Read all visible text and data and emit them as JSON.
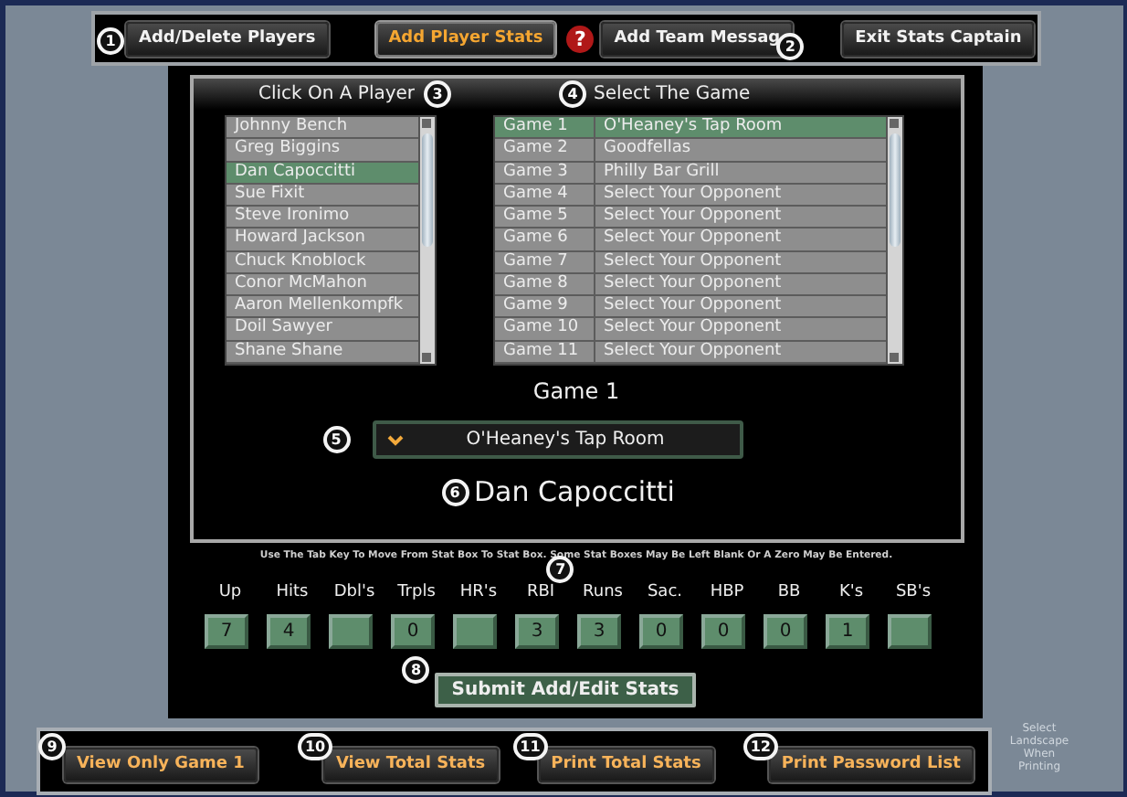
{
  "top_buttons": [
    {
      "label": "Add/Delete Players",
      "selected": false,
      "badge": "1"
    },
    {
      "label": "Add Player Stats",
      "selected": true
    },
    {
      "label": "Add Team Messag",
      "selected": false,
      "badge": "2"
    },
    {
      "label": "Exit Stats Captain",
      "selected": false
    }
  ],
  "help_button": {
    "label": "?"
  },
  "players": {
    "heading": "Click On A Player",
    "badge": "3",
    "items": [
      {
        "name": "Johnny Bench",
        "selected": false
      },
      {
        "name": "Greg Biggins",
        "selected": false
      },
      {
        "name": "Dan Capoccitti",
        "selected": true
      },
      {
        "name": "Sue Fixit",
        "selected": false
      },
      {
        "name": "Steve Ironimo",
        "selected": false
      },
      {
        "name": "Howard Jackson",
        "selected": false
      },
      {
        "name": "Chuck Knoblock",
        "selected": false
      },
      {
        "name": "Conor McMahon",
        "selected": false
      },
      {
        "name": "Aaron Mellenkompfk",
        "selected": false
      },
      {
        "name": "Doil Sawyer",
        "selected": false
      },
      {
        "name": "Shane Shane",
        "selected": false
      }
    ]
  },
  "games": {
    "heading": "Select The Game",
    "badge": "4",
    "items": [
      {
        "game": "Game 1",
        "opponent": "O'Heaney's Tap Room",
        "selected": true
      },
      {
        "game": "Game 2",
        "opponent": "Goodfellas",
        "selected": false
      },
      {
        "game": "Game 3",
        "opponent": "Philly Bar Grill",
        "selected": false
      },
      {
        "game": "Game 4",
        "opponent": "Select Your Opponent",
        "selected": false
      },
      {
        "game": "Game 5",
        "opponent": "Select Your Opponent",
        "selected": false
      },
      {
        "game": "Game 6",
        "opponent": "Select Your Opponent",
        "selected": false
      },
      {
        "game": "Game 7",
        "opponent": "Select Your Opponent",
        "selected": false
      },
      {
        "game": "Game 8",
        "opponent": "Select Your Opponent",
        "selected": false
      },
      {
        "game": "Game 9",
        "opponent": "Select Your Opponent",
        "selected": false
      },
      {
        "game": "Game 10",
        "opponent": "Select Your Opponent",
        "selected": false
      },
      {
        "game": "Game 11",
        "opponent": "Select Your Opponent",
        "selected": false
      }
    ]
  },
  "game_title": "Game 1",
  "opponent_select": {
    "value": "O'Heaney's Tap Room",
    "badge": "5"
  },
  "player_name": {
    "text": "Dan Capoccitti",
    "badge": "6"
  },
  "hint": {
    "text": "Use The Tab Key To Move From Stat Box To Stat Box. Some Stat Boxes May Be Left Blank Or A Zero May Be Entered.",
    "badge": "7"
  },
  "stats": [
    {
      "label": "Up",
      "value": "7"
    },
    {
      "label": "Hits",
      "value": "4"
    },
    {
      "label": "Dbl's"
    },
    {
      "label": "Trpls",
      "value": "0"
    },
    {
      "label": "HR's"
    },
    {
      "label": "RBI",
      "value": "3"
    },
    {
      "label": "Runs",
      "value": "3"
    },
    {
      "label": "Sac.",
      "value": "0"
    },
    {
      "label": "HBP",
      "value": "0"
    },
    {
      "label": "BB",
      "value": "0"
    },
    {
      "label": "K's",
      "value": "1"
    },
    {
      "label": "SB's"
    }
  ],
  "submit": {
    "label": "Submit Add/Edit Stats",
    "badge": "8"
  },
  "bottom_buttons": [
    {
      "label": "View Only Game 1",
      "badge": "9"
    },
    {
      "label": "View Total Stats",
      "badge": "10"
    },
    {
      "label": "Print Total Stats",
      "badge": "11"
    },
    {
      "label": "Print Password List",
      "badge": "12"
    }
  ],
  "side_note": "Select Landscape When Printing"
}
